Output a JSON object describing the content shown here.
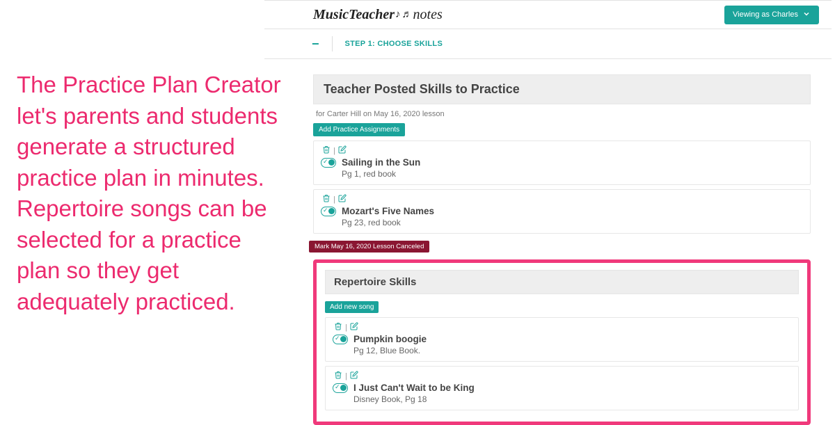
{
  "caption": "The Practice Plan Creator let's parents and students generate a structured practice plan in minutes. Repertoire songs can be selected for a practice plan so they get adequately practiced.",
  "brand": {
    "part1": "MusicTeacher",
    "part2": "notes"
  },
  "viewing_as": "Viewing as Charles",
  "step_label": "STEP 1: CHOOSE SKILLS",
  "posted": {
    "title": "Teacher Posted Skills to Practice",
    "subline": "for Carter Hill on May 16, 2020 lesson",
    "add_btn": "Add Practice Assignments",
    "items": [
      {
        "name": "Sailing in the Sun",
        "detail": "Pg 1, red book"
      },
      {
        "name": "Mozart's Five Names",
        "detail": "Pg 23, red book"
      }
    ],
    "cancel_badge": "Mark May 16, 2020 Lesson Canceled"
  },
  "repertoire": {
    "title": "Repertoire Skills",
    "add_btn": "Add new song",
    "items": [
      {
        "name": "Pumpkin boogie",
        "detail": "Pg 12, Blue Book."
      },
      {
        "name": "I Just Can't Wait to be King",
        "detail": "Disney Book, Pg 18"
      }
    ]
  }
}
